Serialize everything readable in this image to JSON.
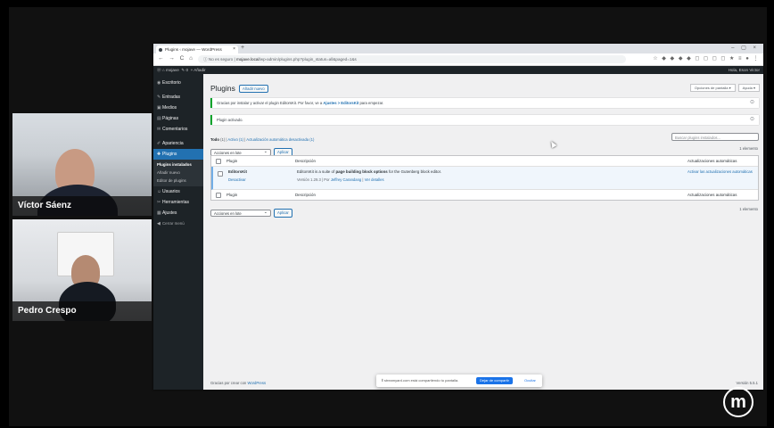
{
  "participants": [
    {
      "name": "Víctor Sáenz"
    },
    {
      "name": "Pedro Crespo"
    }
  ],
  "browser": {
    "tab_title": "Plugins ‹ mojave — WordPress",
    "url_prefix": "No es seguro",
    "url_host": "mojave.local",
    "url_path": "/wp-admin/plugins.php?plugin_status=all&paged=1&s"
  },
  "adminbar": {
    "site_name": "mojave",
    "new_label": "+ Añadir",
    "greeting": "Hola, Eson Victor"
  },
  "sidebar": {
    "items": [
      {
        "icon": "dashboard-icon",
        "glyph": "◉",
        "label": "Escritorio"
      },
      {
        "icon": "pin-icon",
        "glyph": "✎",
        "label": "Entradas"
      },
      {
        "icon": "media-icon",
        "glyph": "▣",
        "label": "Medios"
      },
      {
        "icon": "pages-icon",
        "glyph": "▤",
        "label": "Páginas"
      },
      {
        "icon": "comments-icon",
        "glyph": "✉",
        "label": "Comentarios"
      },
      {
        "icon": "appearance-icon",
        "glyph": "✐",
        "label": "Apariencia"
      },
      {
        "icon": "plugins-icon",
        "glyph": "✚",
        "label": "Plugins"
      },
      {
        "icon": "users-icon",
        "glyph": "☺",
        "label": "Usuarios"
      },
      {
        "icon": "tools-icon",
        "glyph": "✂",
        "label": "Herramientas"
      },
      {
        "icon": "settings-icon",
        "glyph": "▦",
        "label": "Ajustes"
      },
      {
        "icon": "collapse-icon",
        "glyph": "◀",
        "label": "Cerrar menú"
      }
    ],
    "submenu": [
      "Plugins instalados",
      "Añadir nuevo",
      "Editor de plugins"
    ]
  },
  "main": {
    "screen_options": "Opciones de pantalla ▾",
    "help": "Ayuda ▾",
    "title": "Plugins",
    "add_new": "Añadir nuevo",
    "notice1_text": "Gracias por instalar y activar el plugin EditorsKit. Por favor, ve a ",
    "notice1_link": "Ajustes > EditorsKit",
    "notice1_tail": " para empezar.",
    "notice2_text": "Plugin activado.",
    "filter_all": "Todo",
    "filter_all_count": "(1)",
    "filter_active": "Activo (1)",
    "filter_auto": "Actualización automática desactivada (1)",
    "search_placeholder": "Buscar plugins instalados...",
    "bulk_actions": "Acciones en lote",
    "apply": "Aplicar",
    "items_count": "1 elemento",
    "col_plugin": "Plugin",
    "col_description": "Descripción",
    "col_auto": "Actualizaciones automáticas",
    "plugin_name": "EditorsKit",
    "plugin_deactivate": "Desactivar",
    "plugin_desc_pre": "EditorsKit is a suite of ",
    "plugin_desc_bold": "page building block options",
    "plugin_desc_post": " for the Gutenberg block editor.",
    "plugin_version": "Versión 1.29.3 | Por ",
    "plugin_author": "Jeffrey Carandang",
    "plugin_sep": " | ",
    "plugin_details": "Ver detalles",
    "plugin_auto_link": "Activar las actualizaciones automáticas",
    "footer_pre": "Gracias por crear con ",
    "footer_link": "WordPress",
    "version": "Versión 5.5.1"
  },
  "sharebar": {
    "text": "streamyard.com está compartiendo tu pantalla.",
    "stop": "Dejar de compartir",
    "hide": "Ocultar"
  },
  "logo_letter": "m"
}
